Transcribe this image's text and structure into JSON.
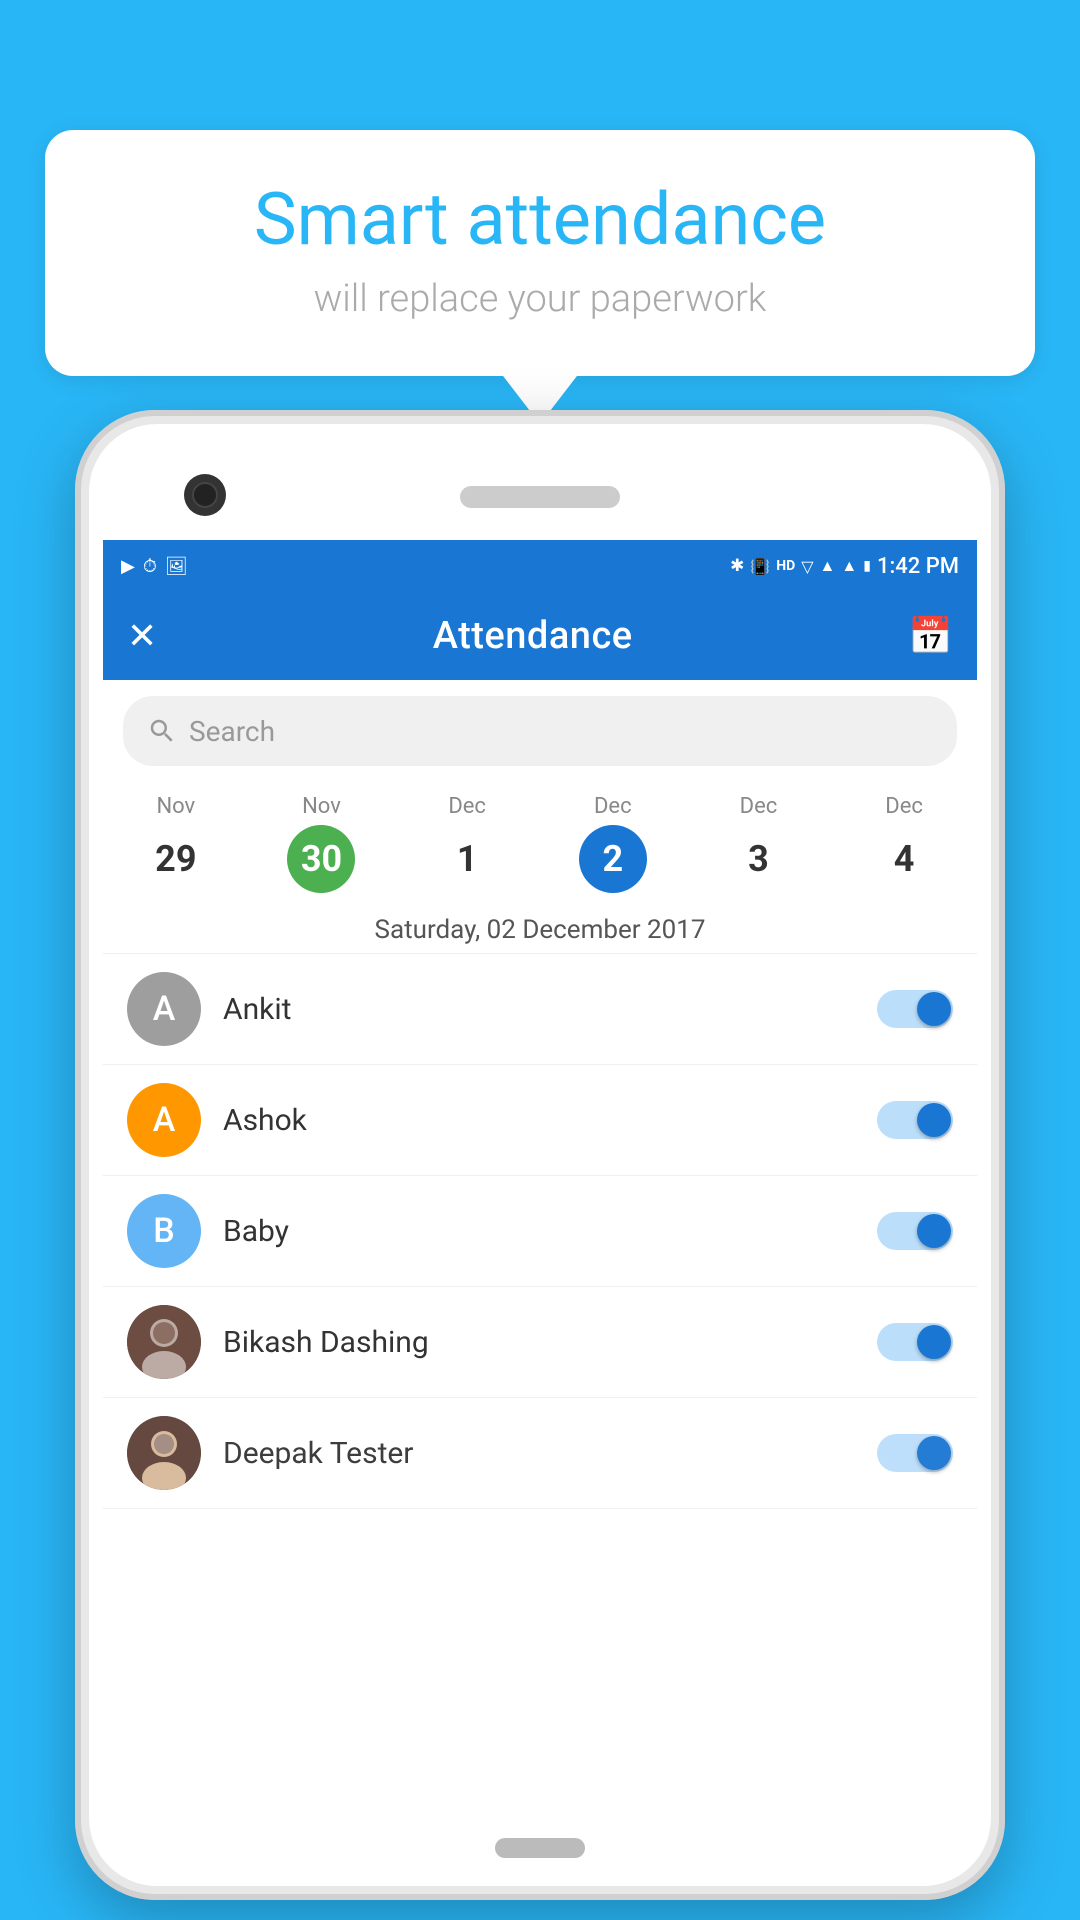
{
  "page": {
    "background_color": "#29b6f6"
  },
  "bubble": {
    "title": "Smart attendance",
    "subtitle": "will replace your paperwork"
  },
  "status_bar": {
    "time": "1:42 PM",
    "icons_left": [
      "youtube-icon",
      "clock-icon",
      "photo-icon"
    ],
    "icons_right": [
      "bluetooth-icon",
      "vibrate-icon",
      "hd-icon",
      "wifi-icon",
      "signal1-icon",
      "signal2-icon",
      "battery-icon"
    ]
  },
  "app_bar": {
    "title": "Attendance",
    "close_label": "✕",
    "calendar_label": "📅"
  },
  "search": {
    "placeholder": "Search"
  },
  "calendar": {
    "days": [
      {
        "month": "Nov",
        "day": "29",
        "style": "normal"
      },
      {
        "month": "Nov",
        "day": "30",
        "style": "green"
      },
      {
        "month": "Dec",
        "day": "1",
        "style": "normal"
      },
      {
        "month": "Dec",
        "day": "2",
        "style": "blue"
      },
      {
        "month": "Dec",
        "day": "3",
        "style": "normal"
      },
      {
        "month": "Dec",
        "day": "4",
        "style": "normal"
      }
    ],
    "selected_date": "Saturday, 02 December 2017"
  },
  "persons": [
    {
      "name": "Ankit",
      "initial": "A",
      "avatar_style": "gray",
      "toggle_on": true
    },
    {
      "name": "Ashok",
      "initial": "A",
      "avatar_style": "orange",
      "toggle_on": true
    },
    {
      "name": "Baby",
      "initial": "B",
      "avatar_style": "lightblue",
      "toggle_on": true
    },
    {
      "name": "Bikash Dashing",
      "initial": "",
      "avatar_style": "photo1",
      "toggle_on": true
    },
    {
      "name": "Deepak Tester",
      "initial": "",
      "avatar_style": "photo2",
      "toggle_on": true
    }
  ]
}
